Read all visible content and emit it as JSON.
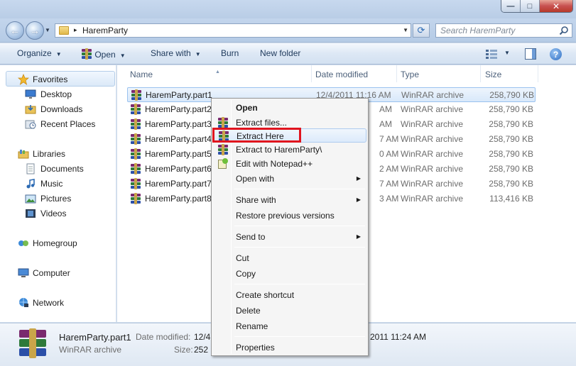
{
  "window": {
    "minimize_glyph": "—",
    "maximize_glyph": "□",
    "close_glyph": "✕"
  },
  "address": {
    "back_glyph": "←",
    "forward_glyph": "→",
    "crumb_arrow": "▸",
    "path": "HaremParty",
    "dropdown_glyph": "▼",
    "refresh_glyph": "⟳",
    "search_placeholder": "Search HaremParty"
  },
  "toolbar": {
    "organize": "Organize",
    "open": "Open",
    "share_with": "Share with",
    "burn": "Burn",
    "new_folder": "New folder",
    "caret": "▼",
    "help": "?"
  },
  "navigation": {
    "favorites": "Favorites",
    "desktop": "Desktop",
    "downloads": "Downloads",
    "recent_places": "Recent Places",
    "libraries": "Libraries",
    "documents": "Documents",
    "music": "Music",
    "pictures": "Pictures",
    "videos": "Videos",
    "homegroup": "Homegroup",
    "computer": "Computer",
    "network": "Network"
  },
  "columns": {
    "name": "Name",
    "date_modified": "Date modified",
    "type": "Type",
    "size": "Size",
    "sort_glyph": "▲"
  },
  "files": [
    {
      "name": "HaremParty.part1",
      "date": "12/4/2011 11:16 AM",
      "type": "WinRAR archive",
      "size": "258,790 KB"
    },
    {
      "name": "HaremParty.part2",
      "date": "AM",
      "type": "WinRAR archive",
      "size": "258,790 KB"
    },
    {
      "name": "HaremParty.part3",
      "date": "AM",
      "type": "WinRAR archive",
      "size": "258,790 KB"
    },
    {
      "name": "HaremParty.part4",
      "date": "7 AM",
      "type": "WinRAR archive",
      "size": "258,790 KB"
    },
    {
      "name": "HaremParty.part5",
      "date": "0 AM",
      "type": "WinRAR archive",
      "size": "258,790 KB"
    },
    {
      "name": "HaremParty.part6",
      "date": "2 AM",
      "type": "WinRAR archive",
      "size": "258,790 KB"
    },
    {
      "name": "HaremParty.part7",
      "date": "7 AM",
      "type": "WinRAR archive",
      "size": "258,790 KB"
    },
    {
      "name": "HaremParty.part8",
      "date": "3 AM",
      "type": "WinRAR archive",
      "size": "113,416 KB"
    }
  ],
  "details_pane": {
    "filename": "HaremParty.part1",
    "date_label": "Date modified:",
    "date_value_left": "12/4",
    "date_value_right": "2011 11:24 AM",
    "type": "WinRAR archive",
    "size_label": "Size:",
    "size_value": "252 I"
  },
  "context_menu": {
    "open": "Open",
    "extract_files": "Extract files...",
    "extract_here": "Extract Here",
    "extract_to": "Extract to HaremParty\\",
    "edit_notepad": "Edit with Notepad++",
    "open_with": "Open with",
    "share_with": "Share with",
    "restore_versions": "Restore previous versions",
    "send_to": "Send to",
    "cut": "Cut",
    "copy": "Copy",
    "create_shortcut": "Create shortcut",
    "delete": "Delete",
    "rename": "Rename",
    "properties": "Properties",
    "submenu_glyph": "▶"
  },
  "colors": {
    "highlight_box": "#e0141e",
    "selection": "#d8e8fa"
  }
}
